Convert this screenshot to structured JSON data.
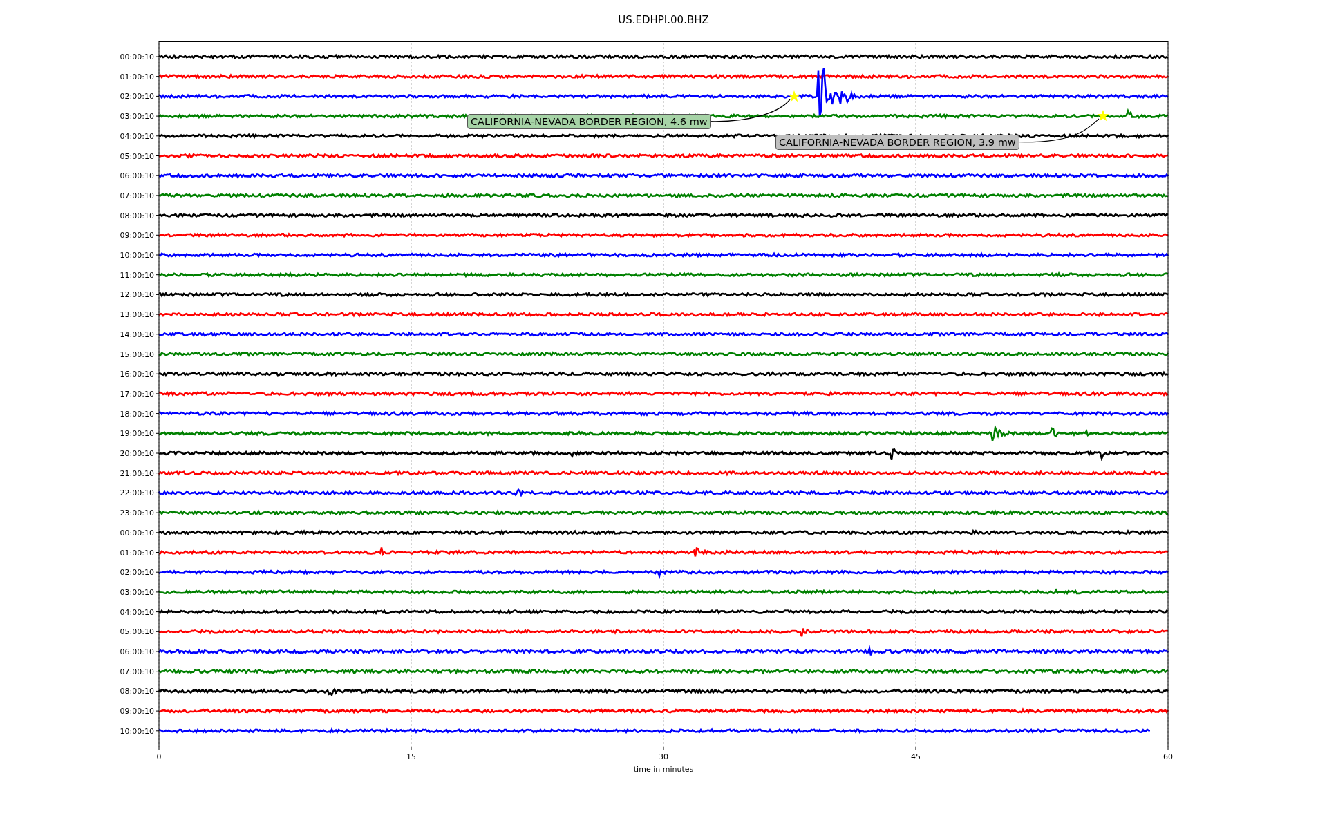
{
  "title": "US.EDHPI.00.BHZ",
  "xlabel": "time in minutes",
  "xticks": [
    "0",
    "15",
    "30",
    "45",
    "60"
  ],
  "rows": [
    {
      "label": "00:00:10",
      "color": "#000000"
    },
    {
      "label": "01:00:10",
      "color": "#ff0000"
    },
    {
      "label": "02:00:10",
      "color": "#0000ff"
    },
    {
      "label": "03:00:10",
      "color": "#008000"
    },
    {
      "label": "04:00:10",
      "color": "#000000"
    },
    {
      "label": "05:00:10",
      "color": "#ff0000"
    },
    {
      "label": "06:00:10",
      "color": "#0000ff"
    },
    {
      "label": "07:00:10",
      "color": "#008000"
    },
    {
      "label": "08:00:10",
      "color": "#000000"
    },
    {
      "label": "09:00:10",
      "color": "#ff0000"
    },
    {
      "label": "10:00:10",
      "color": "#0000ff"
    },
    {
      "label": "11:00:10",
      "color": "#008000"
    },
    {
      "label": "12:00:10",
      "color": "#000000"
    },
    {
      "label": "13:00:10",
      "color": "#ff0000"
    },
    {
      "label": "14:00:10",
      "color": "#0000ff"
    },
    {
      "label": "15:00:10",
      "color": "#008000"
    },
    {
      "label": "16:00:10",
      "color": "#000000"
    },
    {
      "label": "17:00:10",
      "color": "#ff0000"
    },
    {
      "label": "18:00:10",
      "color": "#0000ff"
    },
    {
      "label": "19:00:10",
      "color": "#008000"
    },
    {
      "label": "20:00:10",
      "color": "#000000"
    },
    {
      "label": "21:00:10",
      "color": "#ff0000"
    },
    {
      "label": "22:00:10",
      "color": "#0000ff"
    },
    {
      "label": "23:00:10",
      "color": "#008000"
    },
    {
      "label": "00:00:10",
      "color": "#000000"
    },
    {
      "label": "01:00:10",
      "color": "#ff0000"
    },
    {
      "label": "02:00:10",
      "color": "#0000ff"
    },
    {
      "label": "03:00:10",
      "color": "#008000"
    },
    {
      "label": "04:00:10",
      "color": "#000000"
    },
    {
      "label": "05:00:10",
      "color": "#ff0000"
    },
    {
      "label": "06:00:10",
      "color": "#0000ff"
    },
    {
      "label": "07:00:10",
      "color": "#008000"
    },
    {
      "label": "08:00:10",
      "color": "#000000"
    },
    {
      "label": "09:00:10",
      "color": "#ff0000"
    },
    {
      "label": "10:00:10",
      "color": "#0000ff"
    }
  ],
  "annotations": [
    {
      "text": "CALIFORNIA-NEVADA BORDER REGION, 4.6 mw",
      "color": "#a6d3a6"
    },
    {
      "text": "CALIFORNIA-NEVADA BORDER REGION, 3.9 mw",
      "color": "#bfbfbf"
    }
  ]
}
